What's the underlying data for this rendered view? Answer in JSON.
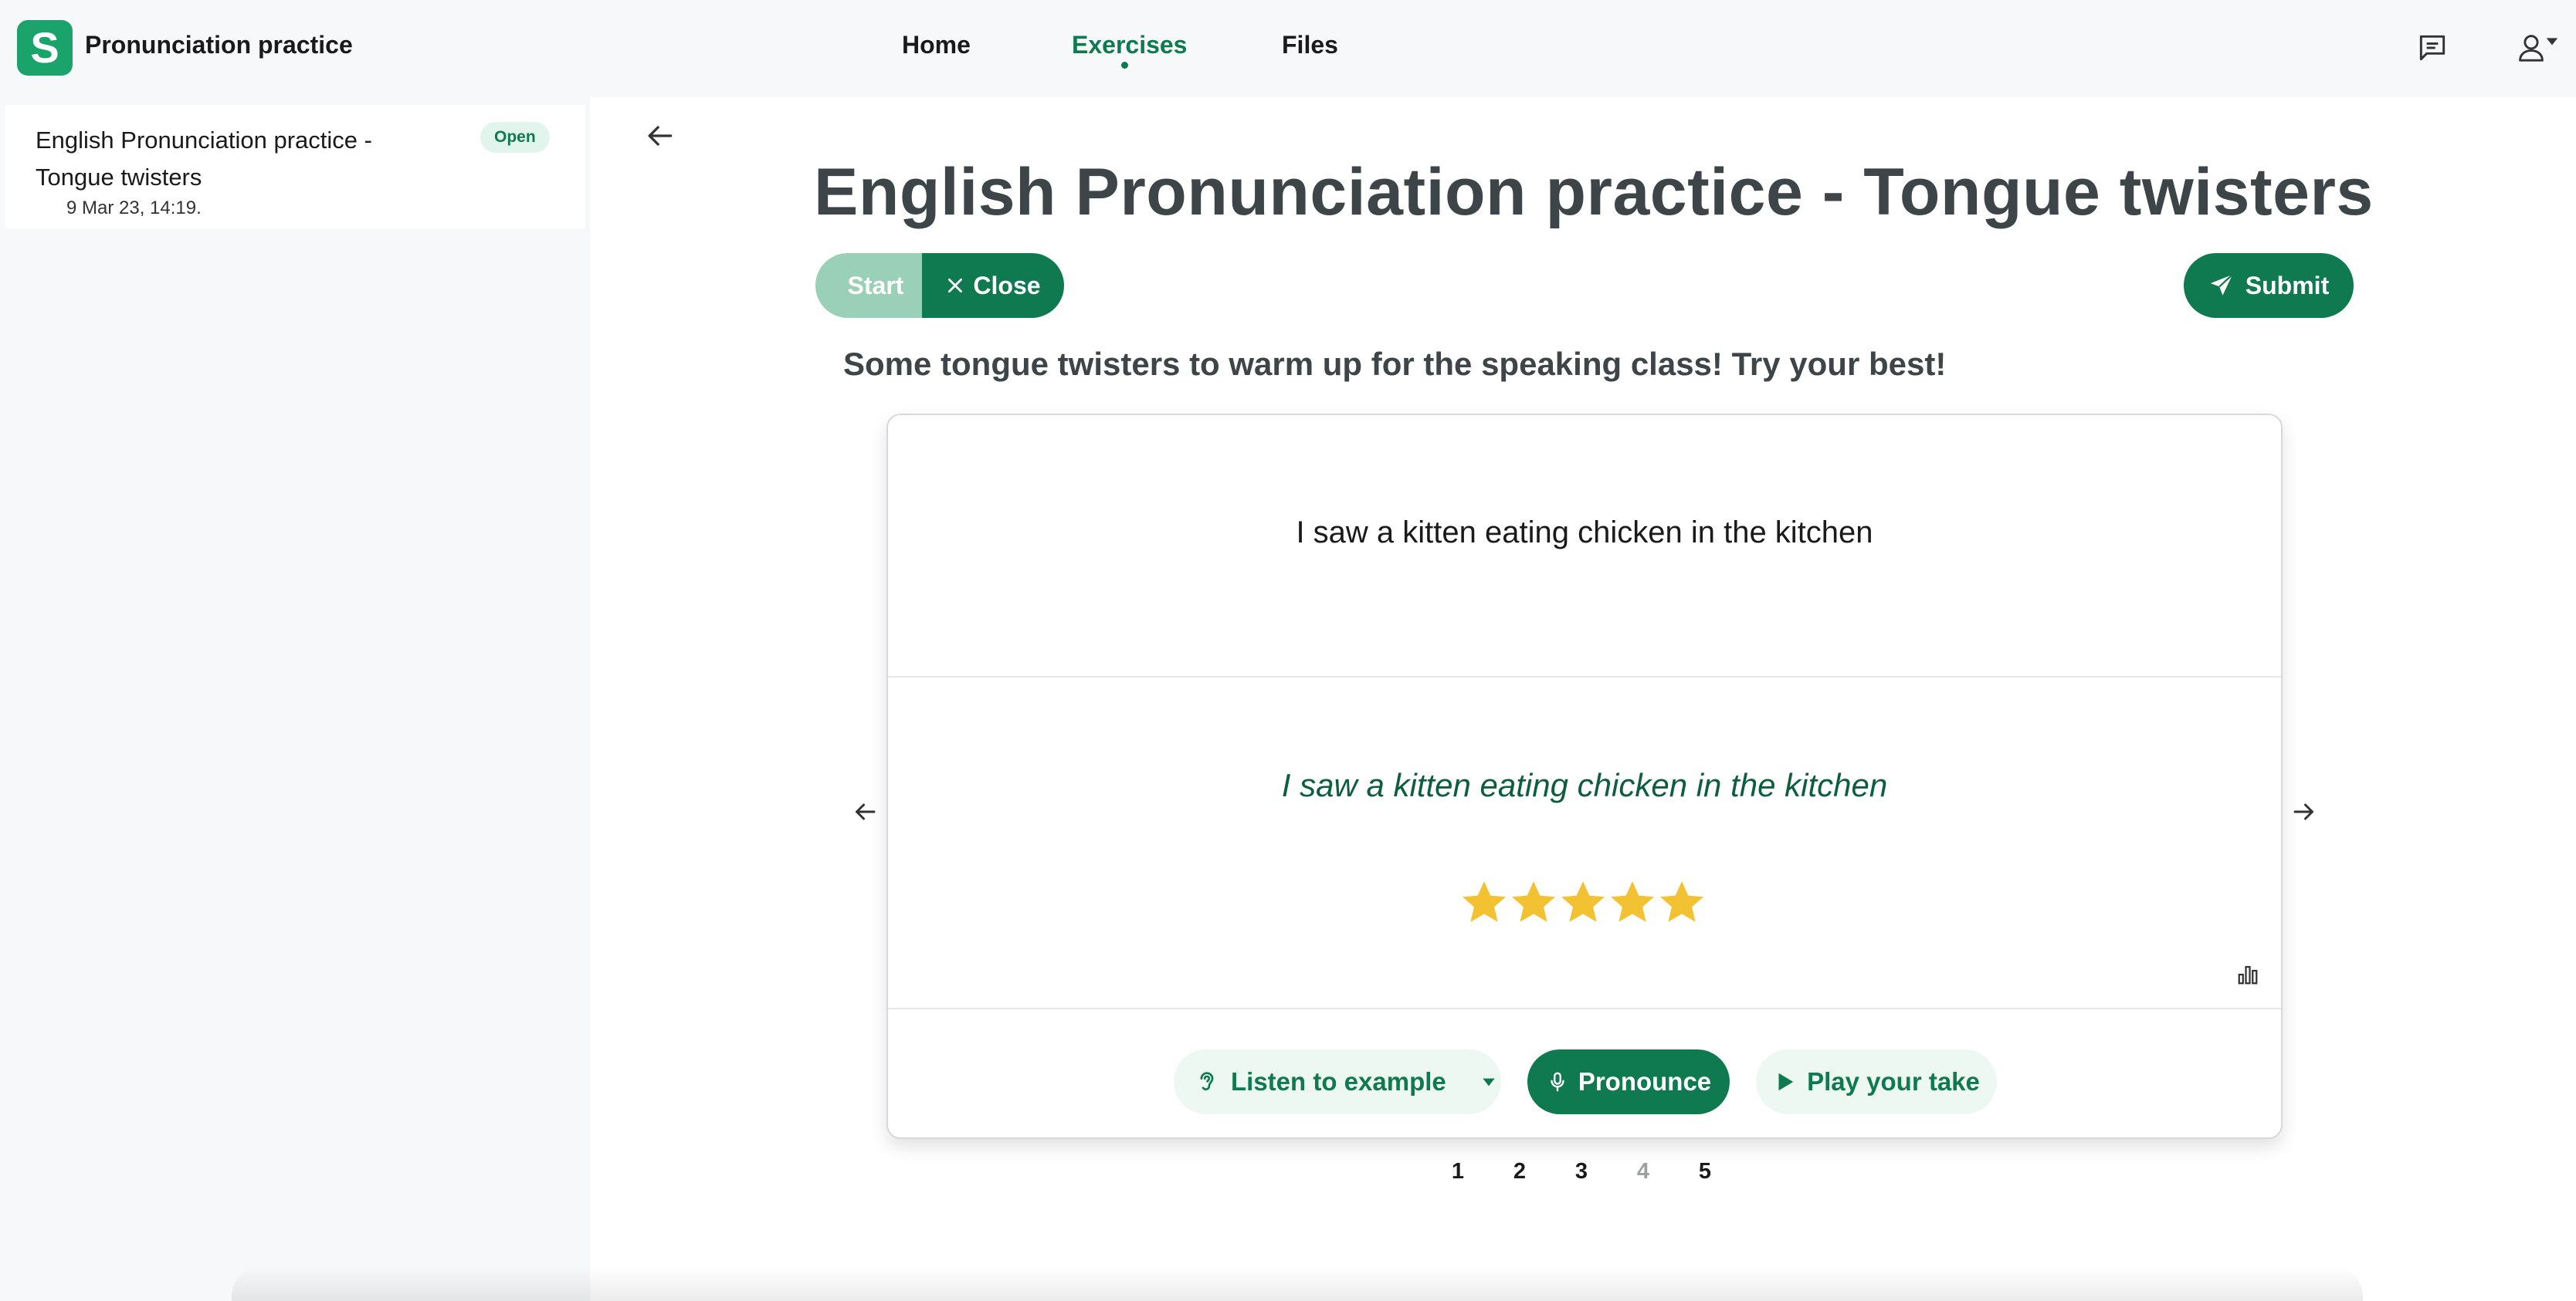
{
  "app": {
    "logo_letter": "S",
    "title": "Pronunciation practice"
  },
  "nav": {
    "items": [
      {
        "label": "Home",
        "active": false
      },
      {
        "label": "Exercises",
        "active": true
      },
      {
        "label": "Files",
        "active": false
      }
    ],
    "icons": [
      "chat-icon",
      "user-menu-icon"
    ]
  },
  "sidebar": {
    "items": [
      {
        "title": "English Pronunciation practice - Tongue twisters",
        "date": "9 Mar 23, 14:19.",
        "badge": "Open"
      }
    ]
  },
  "exercise": {
    "title": "English Pronunciation practice - Tongue twisters",
    "start_label": "Start",
    "close_label": "Close",
    "submit_label": "Submit",
    "description": "Some tongue twisters to warm up for the speaking class! Try your best!",
    "card": {
      "sentence": "I saw a kitten eating chicken in the kitchen",
      "recognized": "I saw a kitten eating chicken in the kitchen",
      "rating": 5,
      "rating_max": 5,
      "listen_label": "Listen to example",
      "pronounce_label": "Pronounce",
      "play_label": "Play your take"
    },
    "pager": {
      "pages": [
        "1",
        "2",
        "3",
        "4",
        "5"
      ],
      "current": "4"
    }
  },
  "colors": {
    "brand": "#0f7a4f",
    "accent_light": "#eef8f3",
    "star": "#f2c233",
    "logo": "#1aa36b"
  }
}
